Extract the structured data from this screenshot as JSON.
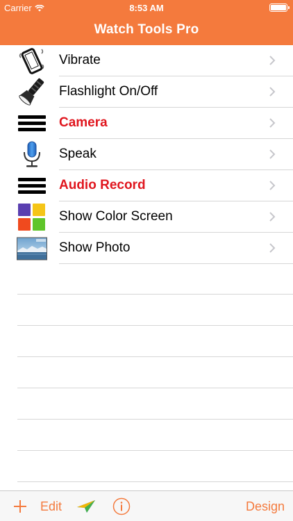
{
  "status_bar": {
    "carrier": "Carrier",
    "time": "8:53 AM"
  },
  "nav": {
    "title": "Watch Tools Pro"
  },
  "list": {
    "items": [
      {
        "label": "Vibrate",
        "icon": "vibrate-phone-icon",
        "color": "#000000"
      },
      {
        "label": "Flashlight On/Off",
        "icon": "flashlight-icon",
        "color": "#000000"
      },
      {
        "label": "Camera",
        "icon": "menu-lines-icon",
        "color": "#e0161e"
      },
      {
        "label": "Speak",
        "icon": "microphone-icon",
        "color": "#000000"
      },
      {
        "label": "Audio Record",
        "icon": "menu-lines-icon",
        "color": "#e0161e"
      },
      {
        "label": "Show Color Screen",
        "icon": "color-squares-icon",
        "color": "#000000"
      },
      {
        "label": "Show Photo",
        "icon": "landscape-photo-icon",
        "color": "#000000"
      }
    ]
  },
  "toolbar": {
    "edit_label": "Edit",
    "design_label": "Design"
  },
  "colors": {
    "accent": "#f47a3d",
    "highlight_red": "#e0161e",
    "separator": "#d6d6d6"
  }
}
